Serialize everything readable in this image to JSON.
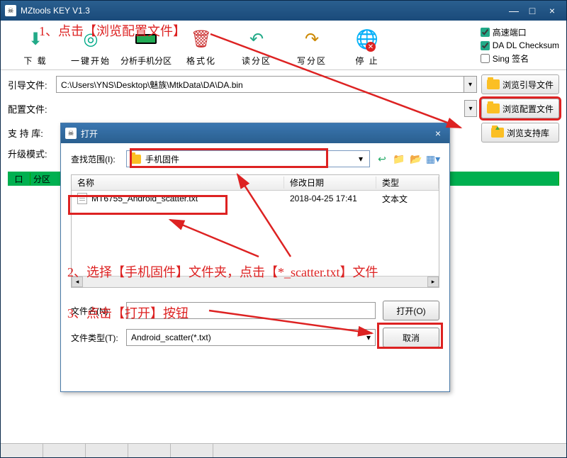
{
  "window": {
    "title": "MZtools KEY V1.3",
    "icon_glyph": "☠"
  },
  "toolbar": {
    "download": "下 载",
    "onekey": "一键开始",
    "analyze": "分析手机分区",
    "format": "格式化",
    "read": "读分区",
    "write": "写分区",
    "stop": "停 止"
  },
  "checks": {
    "highspeed": "高速端口",
    "checksum": "DA DL Checksum",
    "sing": "Sing 签名"
  },
  "rows": {
    "boot_label": "引导文件:",
    "boot_value": "C:\\Users\\YNS\\Desktop\\魅族\\MtkData\\DA\\DA.bin",
    "boot_browse": "浏览引导文件",
    "cfg_label": "配置文件:",
    "cfg_browse": "浏览配置文件",
    "sup_label": "支 持 库:",
    "sup_browse": "浏览支持库",
    "mode_label": "升级模式:"
  },
  "grid": {
    "col1": "口",
    "col2": "分区"
  },
  "dialog": {
    "title": "打开",
    "lookin_label": "查找范围(I):",
    "lookin_value": "手机固件",
    "col_name": "名称",
    "col_date": "修改日期",
    "col_type": "类型",
    "file_name": "MT6755_Android_scatter.txt",
    "file_date": "2018-04-25 17:41",
    "file_type": "文本文",
    "fname_label": "文件名(N):",
    "ftype_label": "文件类型(T):",
    "ftype_value": "Android_scatter(*.txt)",
    "open_btn": "打开(O)",
    "cancel_btn": "取消"
  },
  "anno": {
    "a1": "1、点击【浏览配置文件】",
    "a2": "2、选择【手机固件】文件夹，点击【*_scatter.txt】文件",
    "a3": "3、点击【打开】按钮"
  }
}
